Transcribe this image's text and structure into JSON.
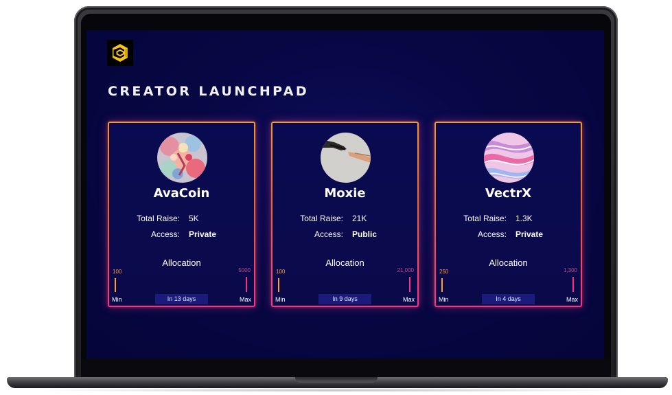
{
  "app": {
    "title": "CREATOR LAUNCHPAD",
    "logo_icon": "hexagon-c-logo-icon",
    "accent": "#f5c518",
    "screen_bg": "#070744",
    "card_border_gradient": [
      "#f59a24",
      "#f0642c",
      "#ff2f88"
    ]
  },
  "labels": {
    "total_raise": "Total Raise:",
    "access": "Access:",
    "allocation": "Allocation",
    "min": "Min",
    "max": "Max"
  },
  "cards": [
    {
      "name": "AvaCoin",
      "total_raise": "5K",
      "access": "Private",
      "min_value": "100",
      "max_value": "5000",
      "ends_in": "In 13 days",
      "avatar": "abstract-floral-painting"
    },
    {
      "name": "Moxie",
      "total_raise": "21K",
      "access": "Public",
      "min_value": "100",
      "max_value": "21,000",
      "ends_in": "In 9 days",
      "avatar": "hands-reaching-photo"
    },
    {
      "name": "VectrX",
      "total_raise": "1.3K",
      "access": "Private",
      "min_value": "250",
      "max_value": "1,300",
      "ends_in": "In 4 days",
      "avatar": "pink-marble-swirl"
    }
  ]
}
